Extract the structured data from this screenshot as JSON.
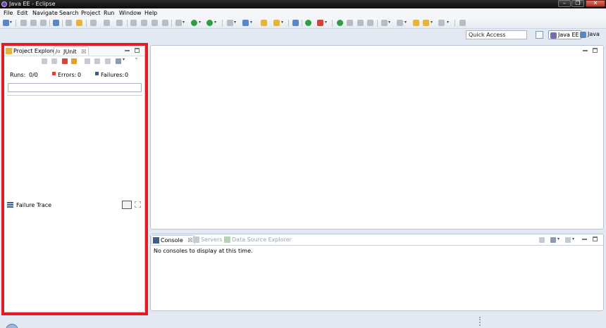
{
  "window": {
    "title": "Java EE - Eclipse",
    "buttons": {
      "minimize": "–",
      "maximize": "❐",
      "close": "✕"
    }
  },
  "menu": [
    "File",
    "Edit",
    "Navigate",
    "Search",
    "Project",
    "Run",
    "Window",
    "Help"
  ],
  "quick_access": {
    "value": "Quick Access"
  },
  "perspectives": [
    {
      "label": "Java EE",
      "icon": "java-ee-perspective-icon",
      "active": true
    },
    {
      "label": "Java",
      "icon": "java-perspective-icon",
      "active": false
    }
  ],
  "left_panel": {
    "tabs": [
      {
        "label": "Project Explorer",
        "icon": "project-explorer-icon",
        "active": false
      },
      {
        "label": "JUnit",
        "icon": "junit-icon",
        "active": true,
        "close": "☒"
      }
    ],
    "junit": {
      "runs_label": "Runs:",
      "runs_value": "0/0",
      "errors_label": "Errors:",
      "errors_value": "0",
      "failures_label": "Failures:",
      "failures_value": "0"
    },
    "failure_trace": {
      "label": "Failure Trace"
    }
  },
  "console_panel": {
    "tabs": [
      {
        "label": "Console",
        "icon": "console-icon",
        "active": true,
        "close": "☒"
      },
      {
        "label": "Servers",
        "icon": "servers-icon",
        "active": false
      },
      {
        "label": "Data Source Explorer",
        "icon": "data-source-explorer-icon",
        "active": false
      }
    ],
    "message": "No consoles to display at this time."
  },
  "colors": {
    "highlight": "#e11c24",
    "workbench_bg": "#e3e9f2",
    "run_green": "#2f9e3c"
  }
}
